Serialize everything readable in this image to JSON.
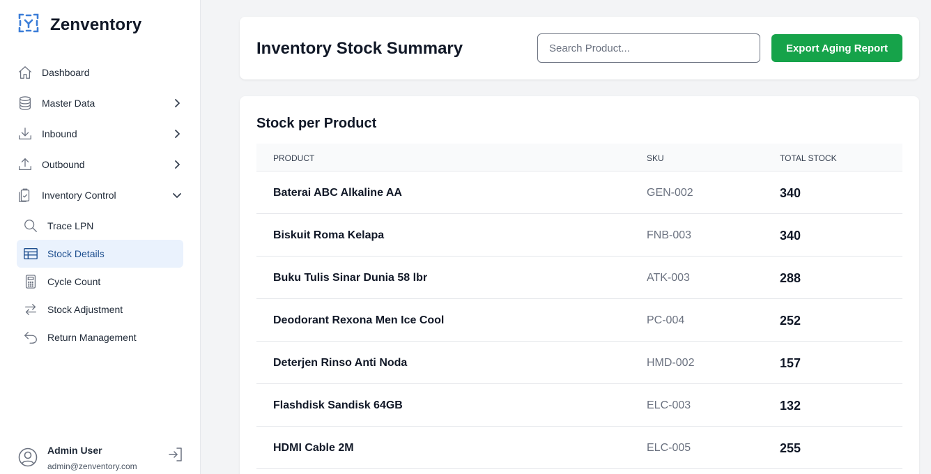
{
  "brand": {
    "name": "Zenventory"
  },
  "sidebar": {
    "items": [
      {
        "label": "Dashboard",
        "icon": "home-icon"
      },
      {
        "label": "Master Data",
        "icon": "database-icon"
      },
      {
        "label": "Inbound",
        "icon": "download-icon"
      },
      {
        "label": "Outbound",
        "icon": "upload-icon"
      },
      {
        "label": "Inventory Control",
        "icon": "clipboard-check-icon"
      }
    ],
    "subitems": [
      {
        "label": "Trace LPN",
        "icon": "search-icon"
      },
      {
        "label": "Stock Details",
        "icon": "table-icon",
        "active": true
      },
      {
        "label": "Cycle Count",
        "icon": "calculator-icon"
      },
      {
        "label": "Stock Adjustment",
        "icon": "arrows-swap-icon"
      },
      {
        "label": "Return Management",
        "icon": "return-icon"
      }
    ]
  },
  "user": {
    "name": "Admin User",
    "email": "admin@zenventory.com"
  },
  "header": {
    "title": "Inventory Stock Summary",
    "search_placeholder": "Search Product...",
    "export_label": "Export Aging Report"
  },
  "table": {
    "title": "Stock per Product",
    "columns": [
      "PRODUCT",
      "SKU",
      "TOTAL STOCK"
    ],
    "rows": [
      {
        "product": "Baterai ABC Alkaline AA",
        "sku": "GEN-002",
        "stock": "340"
      },
      {
        "product": "Biskuit Roma Kelapa",
        "sku": "FNB-003",
        "stock": "340"
      },
      {
        "product": "Buku Tulis Sinar Dunia 58 lbr",
        "sku": "ATK-003",
        "stock": "288"
      },
      {
        "product": "Deodorant Rexona Men Ice Cool",
        "sku": "PC-004",
        "stock": "252"
      },
      {
        "product": "Deterjen Rinso Anti Noda",
        "sku": "HMD-002",
        "stock": "157"
      },
      {
        "product": "Flashdisk Sandisk 64GB",
        "sku": "ELC-003",
        "stock": "132"
      },
      {
        "product": "HDMI Cable 2M",
        "sku": "ELC-005",
        "stock": "255"
      }
    ]
  },
  "colors": {
    "accent": "#16a34a",
    "active_bg": "#eaf2fd",
    "active_text": "#1e4f8f",
    "logo": "#3b7dd8"
  }
}
